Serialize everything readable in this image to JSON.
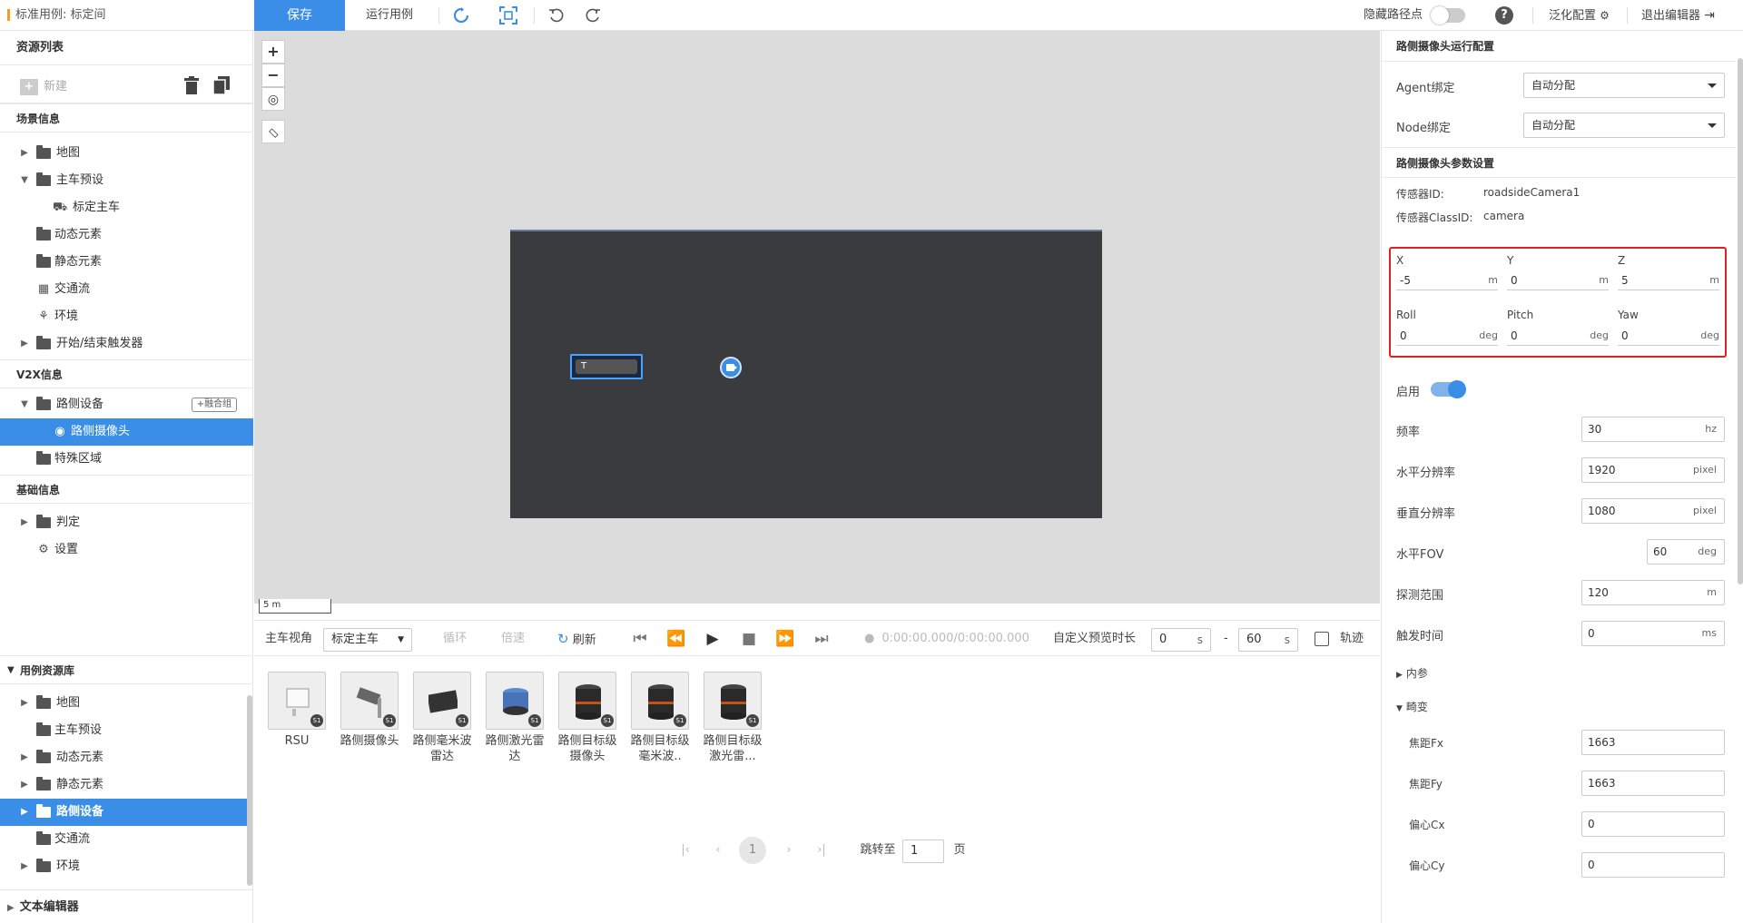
{
  "topbar": {
    "doc_title": "标准用例: 标定间",
    "save_label": "保存",
    "run_label": "运行用例",
    "hide_path_label": "隐藏路径点",
    "generalize_label": "泛化配置",
    "exit_label": "退出编辑器"
  },
  "left": {
    "resource_list": "资源列表",
    "new_label": "新建",
    "scene_info": "场景信息",
    "scene_items": [
      "地图",
      "主车预设",
      "标定主车",
      "动态元素",
      "静态元素",
      "交通流",
      "环境",
      "开始/结束触发器"
    ],
    "v2x_info": "V2X信息",
    "v2x_items": [
      "路侧设备",
      "路侧摄像头",
      "特殊区域"
    ],
    "group_btn": "+融合组",
    "base_info": "基础信息",
    "base_items": [
      "判定",
      "设置"
    ],
    "library_title": "用例资源库",
    "library_items": [
      "地图",
      "主车预设",
      "动态元素",
      "静态元素",
      "路侧设备",
      "交通流",
      "环境"
    ],
    "text_editor": "文本编辑器"
  },
  "canvas": {
    "zoom_in": "+",
    "zoom_out": "−",
    "scale_label": "5 m",
    "car_label": "T"
  },
  "playbar": {
    "view_label": "主车视角",
    "view_value": "标定主车",
    "loop_label": "循环",
    "speed_label": "倍速",
    "refresh_label": "刷新",
    "time_display": "0:00:00.000/0:00:00.000",
    "preview_label": "自定义预览时长",
    "start_value": "0",
    "end_value": "60",
    "unit_s": "s",
    "dash": "-",
    "track_label": "轨迹"
  },
  "library": {
    "items": [
      "RSU",
      "路侧摄像头",
      "路侧毫米波雷达",
      "路侧激光雷达",
      "路侧目标级摄像头",
      "路侧目标级毫米波..",
      "路侧目标级激光雷..."
    ],
    "badge": "S1",
    "pager_current": "1",
    "jump_label": "跳转至",
    "jump_value": "1",
    "page_suffix": "页"
  },
  "right": {
    "run_config_title": "路侧摄像头运行配置",
    "agent_label": "Agent绑定",
    "agent_value": "自动分配",
    "node_label": "Node绑定",
    "node_value": "自动分配",
    "param_title": "路侧摄像头参数设置",
    "sensor_id_label": "传感器ID:",
    "sensor_id_value": "roadsideCamera1",
    "sensor_class_label": "传感器ClassID:",
    "sensor_class_value": "camera",
    "x_label": "X",
    "x_value": "-5",
    "y_label": "Y",
    "y_value": "0",
    "z_label": "Z",
    "z_value": "5",
    "unit_m": "m",
    "roll_label": "Roll",
    "roll_value": "0",
    "pitch_label": "Pitch",
    "pitch_value": "0",
    "yaw_label": "Yaw",
    "yaw_value": "0",
    "unit_deg": "deg",
    "enable_label": "启用",
    "freq_label": "频率",
    "freq_value": "30",
    "freq_unit": "hz",
    "hres_label": "水平分辨率",
    "hres_value": "1920",
    "res_unit": "pixel",
    "vres_label": "垂直分辨率",
    "vres_value": "1080",
    "hfov_label": "水平FOV",
    "hfov_value": "60",
    "range_label": "探测范围",
    "range_value": "120",
    "trigger_label": "触发时间",
    "trigger_value": "0",
    "trigger_unit": "ms",
    "intrinsic_label": "内参",
    "distortion_label": "畸变",
    "fx_label": "焦距Fx",
    "fx_value": "1663",
    "fy_label": "焦距Fy",
    "fy_value": "1663",
    "cx_label": "偏心Cx",
    "cx_value": "0",
    "cy_label": "偏心Cy",
    "cy_value": "0"
  },
  "colors": {
    "accent": "#3b8ee8",
    "highlight_border": "#e02020",
    "canvas_bg": "#dcdcdc",
    "map_bg": "#3a3b3f"
  }
}
